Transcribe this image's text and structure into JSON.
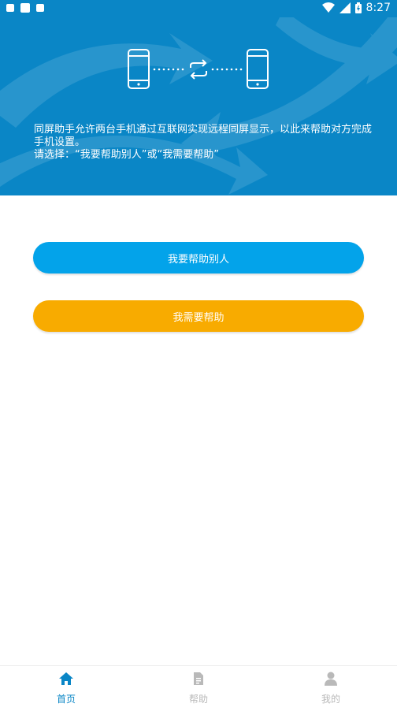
{
  "status_bar": {
    "time": "8:27",
    "icons": [
      "notification-icon",
      "sim-card-icon",
      "photo-icon",
      "wifi-icon",
      "signal-icon",
      "battery-icon"
    ]
  },
  "hero": {
    "description_line1": "同屏助手允许两台手机通过互联网实现远程同屏显示，以此来帮助对方完成手机设置。",
    "description_line2": "请选择：“我要帮助别人”或“我需要帮助”"
  },
  "actions": {
    "help_others_label": "我要帮助别人",
    "need_help_label": "我需要帮助"
  },
  "bottom_nav": {
    "items": [
      {
        "label": "首页",
        "icon": "home-icon",
        "active": true
      },
      {
        "label": "帮助",
        "icon": "document-icon",
        "active": false
      },
      {
        "label": "我的",
        "icon": "user-icon",
        "active": false
      }
    ]
  },
  "colors": {
    "primary": "#0a86c6",
    "button_blue": "#03a3ea",
    "button_orange": "#f8ab00",
    "nav_inactive": "#b9b9b9"
  }
}
